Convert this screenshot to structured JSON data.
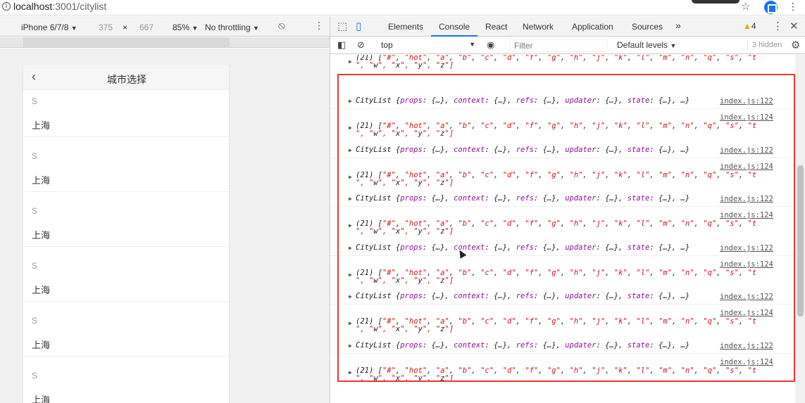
{
  "browser": {
    "url_host": "localhost",
    "url_rest": ":3001/citylist"
  },
  "device_toolbar": {
    "device": "iPhone 6/7/8",
    "width": "375",
    "times": "×",
    "height": "667",
    "zoom": "85%",
    "throttling": "No throttling"
  },
  "app": {
    "title": "城市选择",
    "back_glyph": "‹",
    "groups": [
      {
        "letter": "S",
        "city": "上海"
      },
      {
        "letter": "S",
        "city": "上海"
      },
      {
        "letter": "S",
        "city": "上海"
      },
      {
        "letter": "S",
        "city": "上海"
      },
      {
        "letter": "S",
        "city": "上海"
      },
      {
        "letter": "S",
        "city": "上海"
      }
    ]
  },
  "devtools": {
    "tabs": [
      "Elements",
      "Console",
      "React",
      "Network",
      "Application",
      "Sources"
    ],
    "more": "»",
    "warning_count": "4",
    "context": "top",
    "filter_placeholder": "Filter",
    "levels": "Default levels",
    "hidden": "3 hidden"
  },
  "console": {
    "top_partial": {
      "line1": "(21) [\"#\", \"hot\", \"a\", \"b\", \"c\", \"d\", \"f\", \"g\", \"h\", \"j\", \"k\", \"l\", \"m\", \"n\", \"q\", \"s\", \"t",
      "line2": "\", \"w\", \"x\", \"y\", \"z\"]"
    },
    "obj_text": "CityList {props: {…}, context: {…}, refs: {…}, updater: {…}, state: {…}, …}",
    "obj_src": "index.js:122",
    "arr_line1": "(21) [\"#\", \"hot\", \"a\", \"b\", \"c\", \"d\", \"f\", \"g\", \"h\", \"j\", \"k\", \"l\", \"m\", \"n\", \"q\", \"s\", \"t",
    "arr_line2": "\", \"w\", \"x\", \"y\", \"z\"]",
    "arr_src": "index.js:124",
    "bottom_obj": "CityList {props: {…}, context: {…}, refs: {…}, updater: {…}, state: {…}, …}",
    "bottom_src": "index.js:122",
    "bottom_src2": "index.js:124",
    "bottom_arr": "(21) [\"#\", \"hot\", \"a\", \"b\", \"c\", \"d\", \"f\", \"g\", \"h\", \"j\", \"k\", \"l\", \"m\", \"n\", \"q\", \"s\", \"t"
  },
  "colors": {
    "highlight": "#e53935",
    "accent": "#1a73e8",
    "string": "#c41a16"
  }
}
